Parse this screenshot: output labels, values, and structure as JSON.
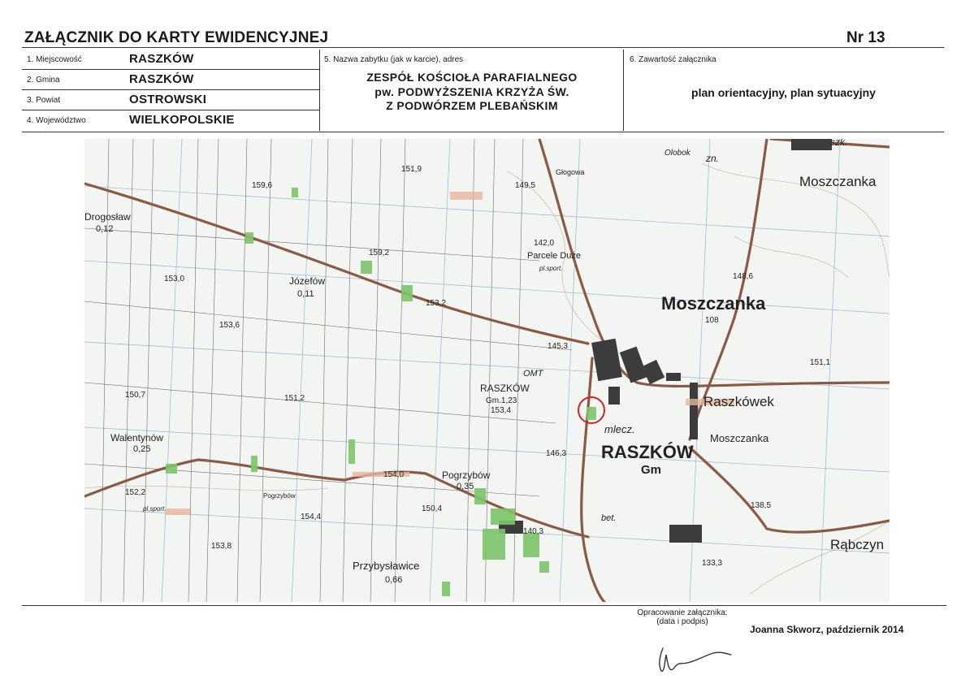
{
  "header": {
    "title": "ZAŁĄCZNIK DO KARTY EWIDENCYJNEJ",
    "number": "Nr 13"
  },
  "info_rows": [
    {
      "label": "1. Miejscowość",
      "value": "RASZKÓW"
    },
    {
      "label": "2. Gmina",
      "value": "RASZKÓW"
    },
    {
      "label": "3. Powiat",
      "value": "OSTROWSKI"
    },
    {
      "label": "4. Województwo",
      "value": "WIELKOPOLSKIE"
    }
  ],
  "monument": {
    "label": "5. Nazwa zabytku (jak w karcie), adres",
    "name_lines": [
      "ZESPÓŁ KOŚCIOŁA PARAFIALNEGO",
      "pw. PODWYŻSZENIA KRZYŻA ŚW.",
      "Z PODWÓRZEM PLEBAŃSKIM"
    ]
  },
  "contents": {
    "label": "6. Zawartość załącznika",
    "value": "plan orientacyjny, plan sytuacyjny"
  },
  "map": {
    "places": [
      {
        "name": "Moszczanka"
      },
      {
        "name": "Moszczanka"
      },
      {
        "name": "Raszkówek"
      },
      {
        "name": "Moszczanka"
      },
      {
        "name": "RASZKÓW"
      },
      {
        "name": "Gm"
      },
      {
        "name": "Rąbczyn"
      },
      {
        "name": "Józefów"
      },
      {
        "name": "0,11"
      },
      {
        "name": "Parcele Duże"
      },
      {
        "name": "RASZKÓW"
      },
      {
        "name": "Gm.1,23"
      },
      {
        "name": "Walentynów"
      },
      {
        "name": "0,25"
      },
      {
        "name": "Pogrzybów"
      },
      {
        "name": "0,35"
      },
      {
        "name": "Przybysławice"
      },
      {
        "name": "0,66"
      },
      {
        "name": "Drogosław"
      },
      {
        "name": "0,12"
      },
      {
        "name": "Głogowa"
      },
      {
        "name": "Pogrzybów"
      },
      {
        "name": "pl.sport."
      },
      {
        "name": "pl.sport."
      },
      {
        "name": "OMT"
      },
      {
        "name": "mlecz."
      },
      {
        "name": "bet."
      },
      {
        "name": "szk."
      },
      {
        "name": "zn."
      },
      {
        "name": "Olobok"
      }
    ],
    "elevations": [
      "149,5",
      "151,9",
      "159,6",
      "159,2",
      "153,0",
      "153,2",
      "153,6",
      "142,0",
      "145,3",
      "153,4",
      "150,7",
      "151,2",
      "148,6",
      "151,1",
      "146,3",
      "154,0",
      "152,2",
      "154,4",
      "150,4",
      "153,8",
      "138,5",
      "133,3",
      "140,3",
      "108"
    ],
    "marker_color": "#d4202a"
  },
  "footer": {
    "prepared_label_lines": [
      "Opracowanie załącznika:",
      "(data i podpis)"
    ],
    "author": "Joanna Skworz, październik 2014"
  }
}
